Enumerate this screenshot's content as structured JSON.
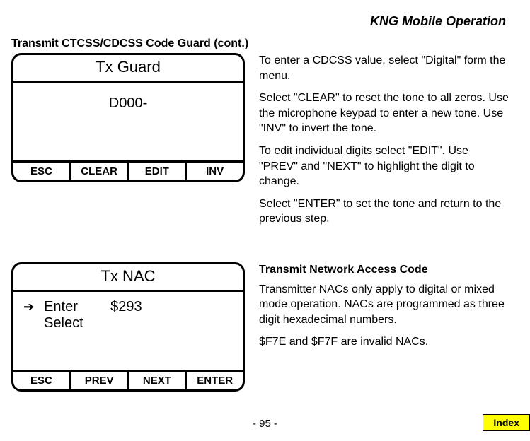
{
  "header": {
    "chapter": "KNG Mobile Operation"
  },
  "section1": {
    "title": "Transmit CTCSS/CDCSS Code Guard (cont.)",
    "device": {
      "title": "Tx Guard",
      "value": "D000-",
      "softkeys": [
        "ESC",
        "CLEAR",
        "EDIT",
        "INV"
      ]
    },
    "paras": [
      "To enter a CDCSS value, select \"Digital\" form the menu.",
      "Select \"CLEAR\" to reset the tone to all zeros. Use the microphone keypad to enter a new tone. Use \"INV\" to invert the tone.",
      "To edit individual digits select \"EDIT\". Use \"PREV\" and \"NEXT\" to highlight the digit to change.",
      "Select \"ENTER\" to set the tone and return to the previous step."
    ]
  },
  "section2": {
    "device": {
      "title": "Tx NAC",
      "line1_label": "Enter",
      "line1_value": "$293",
      "line2_label": "Select",
      "softkeys": [
        "ESC",
        "PREV",
        "NEXT",
        "ENTER"
      ]
    },
    "heading": "Transmit Network Access Code",
    "paras": [
      "Transmitter NACs only apply to digital or mixed mode operation. NACs are programmed as three digit hexadecimal numbers.",
      "$F7E and $F7F are invalid NACs."
    ]
  },
  "footer": {
    "page": "- 95 -",
    "index": "Index"
  }
}
